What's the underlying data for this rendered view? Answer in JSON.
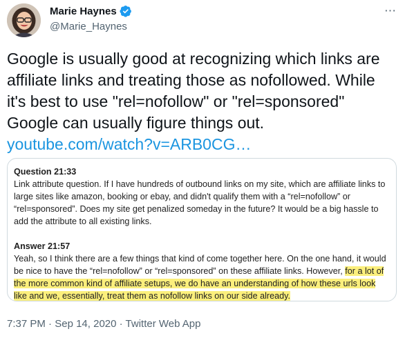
{
  "author": {
    "display_name": "Marie Haynes",
    "handle": "@Marie_Haynes",
    "verified_icon": "verified-badge-icon",
    "avatar_icon": "profile-photo"
  },
  "more_icon": "more-dots-icon",
  "tweet": {
    "text": "Google is usually good at recognizing which links are affiliate links and treating those as nofollowed. While it's best to use \"rel=nofollow\" or \"rel=sponsored\" Google can usually figure things out. ",
    "link": "youtube.com/watch?v=ARB0CG…"
  },
  "card": {
    "question_title": "Question 21:33",
    "question_body": "Link attribute question. If I have hundreds of outbound links on my site, which are affiliate links to large sites like amazon, booking or ebay, and didn't qualify them with a “rel=nofollow” or “rel=sponsored”. Does my site get penalized someday in the future? It would be a big hassle to add the attribute to all existing links.",
    "answer_title": "Answer 21:57",
    "answer_body": "Yeah, so I think there are a few things that kind of come together here. On the one hand, it would be nice to have the “rel=nofollow” or “rel=sponsored” on these affiliate links. However, ",
    "answer_highlight": "for a lot of the more common kind of affiliate setups, we do have an understanding of how these urls look like and we, essentially, treat them as nofollow links on our side already."
  },
  "meta": {
    "time": "7:37 PM",
    "date": "Sep 14, 2020",
    "source": "Twitter Web App",
    "separator": " · "
  },
  "colors": {
    "link": "#1b95e0",
    "verified": "#1d9bf0",
    "highlight": "#fbef7c",
    "secondary_text": "#536471"
  }
}
